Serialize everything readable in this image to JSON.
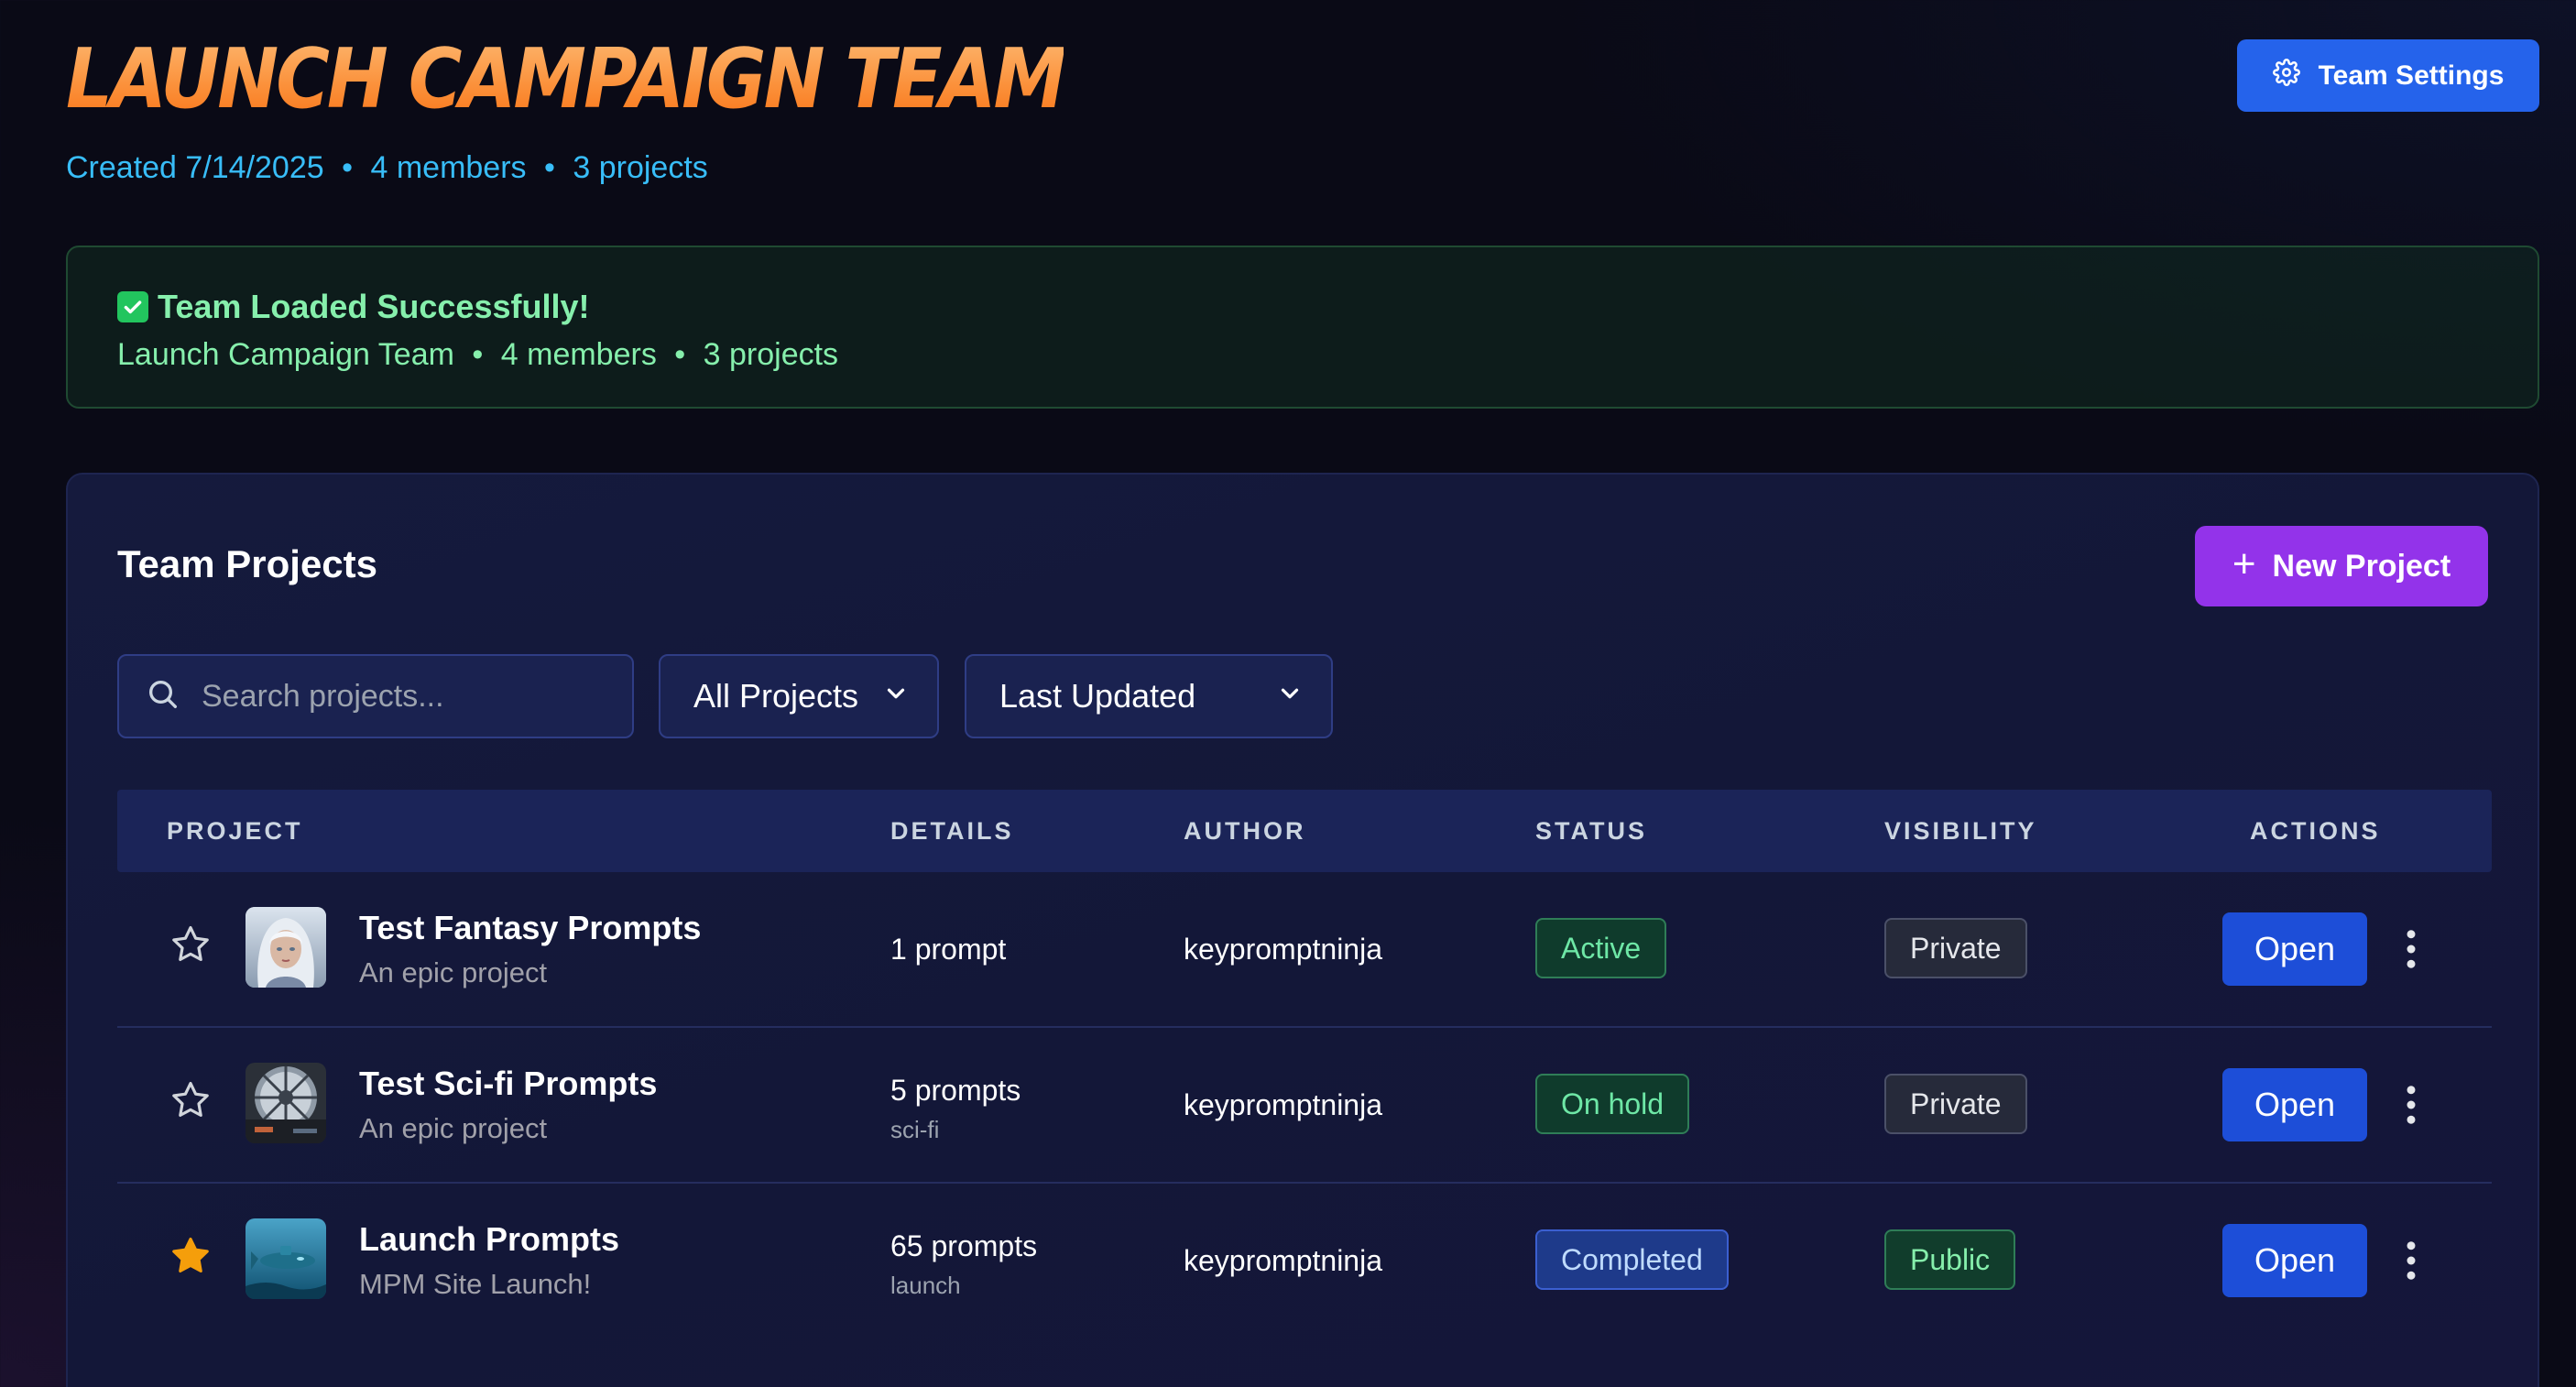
{
  "header": {
    "title": "LAUNCH CAMPAIGN TEAM",
    "meta": {
      "created": "Created 7/14/2025",
      "members": "4 members",
      "projects": "3 projects",
      "separator": "•"
    },
    "settings_button": {
      "label": "Team Settings",
      "icon": "gear-icon"
    }
  },
  "banner": {
    "icon": "check-icon",
    "title": "Team Loaded Successfully!",
    "team_name": "Launch Campaign Team",
    "members": "4 members",
    "projects": "3 projects",
    "separator": "•"
  },
  "projects_panel": {
    "title": "Team Projects",
    "new_project_button": {
      "label": "New Project",
      "icon": "plus-icon"
    },
    "search": {
      "placeholder": "Search projects...",
      "value": ""
    },
    "filter_select": {
      "value": "All Projects"
    },
    "sort_select": {
      "value": "Last Updated"
    },
    "columns": [
      "PROJECT",
      "DETAILS",
      "AUTHOR",
      "STATUS",
      "VISIBILITY",
      "ACTIONS"
    ],
    "rows": [
      {
        "starred": false,
        "thumbnail": "fantasy-portrait-thumbnail",
        "name": "Test Fantasy Prompts",
        "description": "An epic project",
        "count": "1 prompt",
        "tag": "",
        "author": "keypromptninja",
        "status": "Active",
        "visibility": "Private",
        "action": "Open"
      },
      {
        "starred": false,
        "thumbnail": "scifi-cockpit-thumbnail",
        "name": "Test Sci-fi Prompts",
        "description": "An epic project",
        "count": "5 prompts",
        "tag": "sci-fi",
        "author": "keypromptninja",
        "status": "On hold",
        "visibility": "Private",
        "action": "Open"
      },
      {
        "starred": true,
        "thumbnail": "underwater-submarine-thumbnail",
        "name": "Launch Prompts",
        "description": "MPM Site Launch!",
        "count": "65 prompts",
        "tag": "launch",
        "author": "keypromptninja",
        "status": "Completed",
        "visibility": "Public",
        "action": "Open"
      }
    ]
  },
  "colors": {
    "title_orange": "#fb923c",
    "meta_blue": "#38bdf8",
    "settings_blue": "#2563eb",
    "new_project_purple": "#9333ea",
    "success_green": "#86efac",
    "open_button_blue": "#1d4ed8",
    "star_gold": "#f59e0b"
  }
}
